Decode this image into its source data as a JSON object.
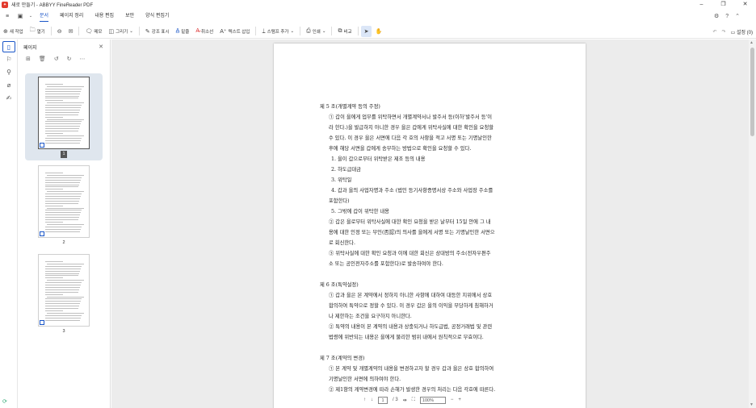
{
  "window": {
    "title": "새로 만들기 - ABBYY FineReader PDF",
    "min": "–",
    "max": "❐",
    "close": "✕"
  },
  "menu": {
    "tabs": [
      {
        "label": "문서"
      },
      {
        "label": "페이지 정리"
      },
      {
        "label": "내용 편집"
      },
      {
        "label": "보안"
      },
      {
        "label": "양식 편집기"
      }
    ]
  },
  "toolbar": {
    "new_task": "새 작업",
    "open": "열기",
    "note": "메모",
    "draw": "그리기",
    "highlight": "강조 표시",
    "underline": "밑줄",
    "strikeout": "취소선",
    "insert_text": "텍스트 삽입",
    "stamp": "스탬프 추가",
    "print": "인쇄",
    "compare": "비교",
    "settings": "설정 (0)"
  },
  "pages_panel": {
    "title": "페이지",
    "thumbnails": [
      {
        "num": "1"
      },
      {
        "num": "2"
      },
      {
        "num": "3"
      }
    ]
  },
  "document": {
    "lines": [
      "제 5 조(개별계약 등의 주정)",
      "① 갑이 을에게 업무를 위탁하면서 개별계약서나 발주서 등(이하'발주서 등'이",
      "라 한다.)을 발급하지 아니한 경우 을은 갑에게 위탁사실에 대한 확인을 요청할",
      "수 있다. 이 경우 을은 서면에 다음 각 호의 사항을 적고 서명 또는 기명날인한",
      "후에 해당 서면을 갑에게 송부하는 방법으로 확인을 요청할 수 있다.",
      "1. 을이 갑으로부터 위탁받은 제조 등의 내용",
      "2. 하도급대금",
      "3. 위탁일",
      "4. 갑과 을의 사업자명과 주소 (법인 등기사항증명서상 주소와 사업장 주소를",
      "포함한다)",
      "5. 그밖에 갑이 위탁한 내용",
      "② 갑은 을로부터 위탁사실에 대한 확인 요청을 받은 날부터 15일 안에 그 내",
      "용에 대한 인정 또는 부인(否認)의 의사를 을에게 서명 또는 기명날인한 서면으",
      "로 회신한다.",
      "③ 위탁사실에 대한 확인 요청과 이에 대한 회신은 상대방의 주소(전자우편주",
      "소 또는 공인전자주소를 포함한다)로 발송하여야 한다.",
      "",
      "제 6 조(특약설정)",
      "① 갑과 을은 본 계약에서 정하지 아니한 사항에 대하여 대등한 지위에서 상호",
      "합의하여 특약으로 정할 수 있다. 이 경우 갑은 을의 이익을 부당하게 침해하거",
      "나 제한하는 조건을 요구하지 아니한다.",
      "② 특약의 내용이 본 계약의 내용과 상충되거나 하도급법, 공정거래법 및 관련",
      "법령에 위반되는 내용은 을에게 불리한 범위 내에서 원칙적으로 무효이다.",
      "",
      "제 7 조(계약의 변경)",
      "① 본 계약 및 개별계약의 내용을 변경하고자 할 경우 갑과 을은 상호 합의하여",
      "기명날인한 서면에 의하여야 한다.",
      "② 제1항의 계약변경에 따라 손해가 발생한 경우의 처리는 다음 각호에 따른다."
    ]
  },
  "status": {
    "page_current": "1",
    "page_total": "/ 3",
    "zoom": "100%"
  }
}
